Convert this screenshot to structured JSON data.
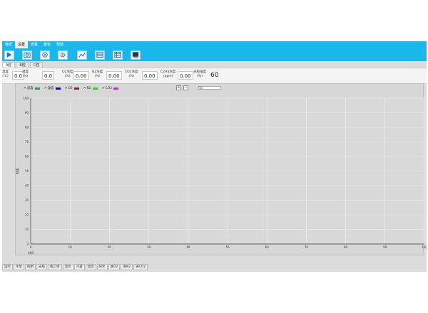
{
  "menu": [
    "通讯",
    "设置",
    "查看",
    "报告",
    "帮助"
  ],
  "menu_active_index": 1,
  "toolbar": [
    {
      "name": "play-icon"
    },
    {
      "name": "camera-icon"
    },
    {
      "name": "lens-icon"
    },
    {
      "name": "gear-icon"
    },
    {
      "name": "chart-icon"
    },
    {
      "name": "table-icon"
    },
    {
      "name": "list-icon"
    },
    {
      "name": "export-icon"
    }
  ],
  "tabs": [
    "A腔",
    "B腔",
    "C腔"
  ],
  "tab_active_index": 0,
  "readings": [
    {
      "label1": "温度",
      "label2": "(℃)",
      "value": "0.0"
    },
    {
      "label1": "湿度",
      "label2": "(%)",
      "value": "0.0"
    },
    {
      "label1": "O2浓度",
      "label2": "(%)",
      "value": "0.00"
    },
    {
      "label1": "N2浓度",
      "label2": "(%)",
      "value": "0.00"
    },
    {
      "label1": "CO2浓度",
      "label2": "(%)",
      "value": "0.00"
    },
    {
      "label1": "C2H4浓度",
      "label2": "(ppm)",
      "value": "0.00"
    },
    {
      "label1": "光照强度",
      "label2": "(%)",
      "value": "60"
    }
  ],
  "legend": [
    {
      "name": "温度",
      "color": "#1fa81f"
    },
    {
      "name": "湿度",
      "color": "#0000ff"
    },
    {
      "name": "O2",
      "color": "#7a1f5a"
    },
    {
      "name": "N2",
      "color": "#00ee00"
    },
    {
      "name": "CO2",
      "color": "#ff00ff"
    }
  ],
  "zoom": "1x",
  "chart_data": {
    "type": "line",
    "series": [],
    "xlabel": "时间",
    "ylabel": "数值",
    "xlim": [
      0,
      100
    ],
    "ylim": [
      0,
      100
    ],
    "x_ticks": [
      0,
      10,
      20,
      30,
      40,
      50,
      60,
      70,
      80,
      90,
      100
    ],
    "y_ticks": [
      0,
      10,
      20,
      30,
      40,
      50,
      60,
      70,
      80,
      90,
      100
    ],
    "grid": true
  },
  "bottom_tabs": [
    "运行",
    "水泵",
    "照明",
    "光照",
    "氮乙烯",
    "温水",
    "冷凝",
    "加湿",
    "除水",
    "进O2",
    "进N2",
    "进CO2"
  ]
}
